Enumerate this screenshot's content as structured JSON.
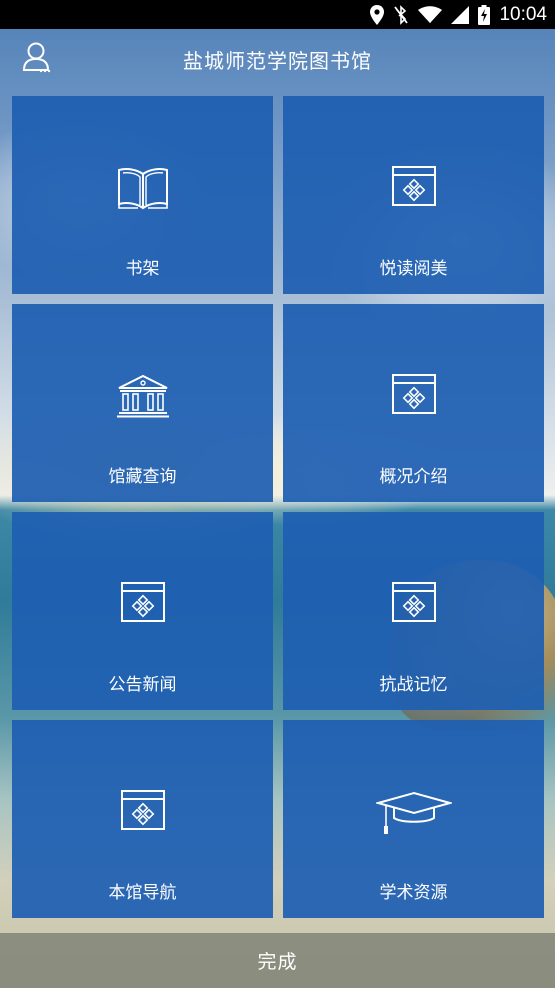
{
  "status_bar": {
    "time": "10:04",
    "icons": [
      "location-icon",
      "bluetooth-off-icon",
      "wifi-icon",
      "signal-icon",
      "battery-charging-icon"
    ]
  },
  "header": {
    "title": "盐城师范学院图书馆",
    "user_icon": "user-icon"
  },
  "tiles": [
    {
      "label": "书架",
      "icon": "book-icon"
    },
    {
      "label": "悦读阅美",
      "icon": "app-window-icon"
    },
    {
      "label": "馆藏查询",
      "icon": "library-building-icon"
    },
    {
      "label": "概况介绍",
      "icon": "app-window-icon"
    },
    {
      "label": "公告新闻",
      "icon": "app-window-icon"
    },
    {
      "label": "抗战记忆",
      "icon": "app-window-icon"
    },
    {
      "label": "本馆导航",
      "icon": "app-window-icon"
    },
    {
      "label": "学术资源",
      "icon": "graduation-cap-icon"
    }
  ],
  "bottom_bar": {
    "done_label": "完成"
  },
  "colors": {
    "tile_background": "#1e5fb2",
    "status_bar": "#000000",
    "text": "#ffffff"
  }
}
